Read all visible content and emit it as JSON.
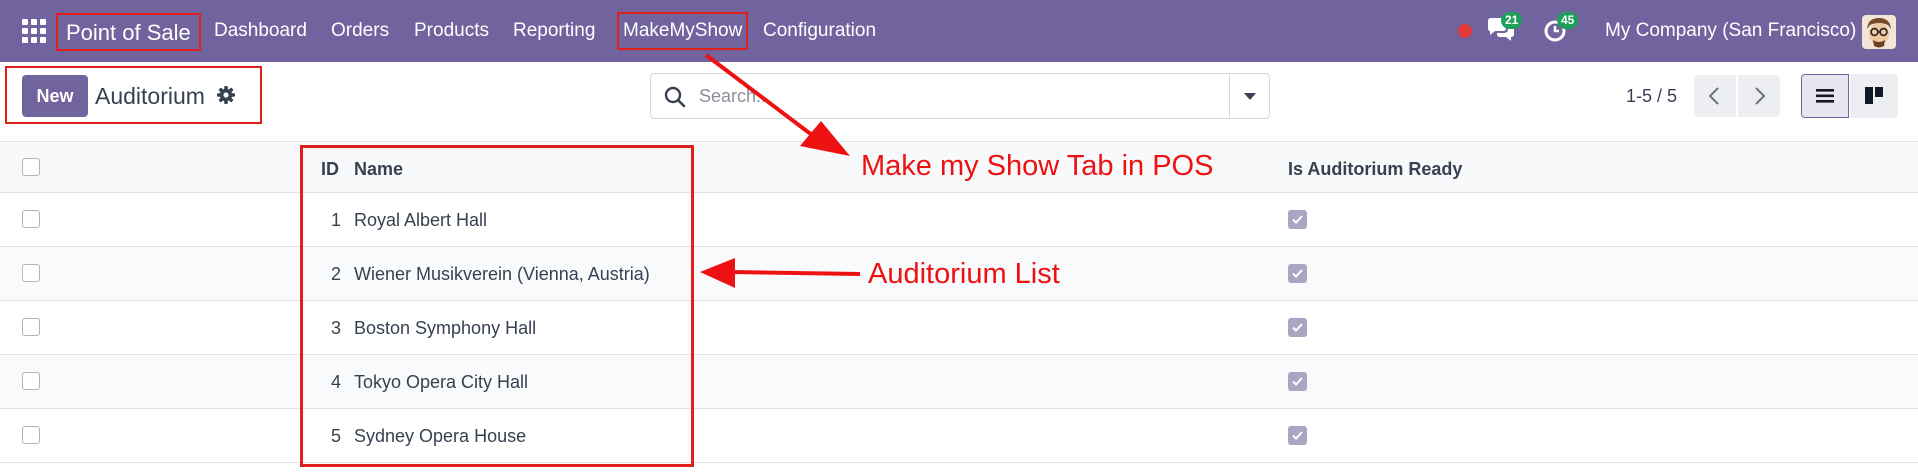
{
  "navbar": {
    "brand": "Point of Sale",
    "menu": [
      "Dashboard",
      "Orders",
      "Products",
      "Reporting",
      "MakeMyShow",
      "Configuration"
    ],
    "messages_count": "21",
    "activities_count": "45",
    "company": "My Company (San Francisco)"
  },
  "control_panel": {
    "new_label": "New",
    "breadcrumb": "Auditorium",
    "search_placeholder": "Search...",
    "pager": "1-5 / 5"
  },
  "table": {
    "columns": {
      "id": "ID",
      "name": "Name",
      "ready": "Is Auditorium Ready"
    },
    "rows": [
      {
        "id": "1",
        "name": "Royal Albert Hall",
        "ready": true
      },
      {
        "id": "2",
        "name": "Wiener Musikverein (Vienna, Austria)",
        "ready": true
      },
      {
        "id": "3",
        "name": "Boston Symphony Hall",
        "ready": true
      },
      {
        "id": "4",
        "name": "Tokyo Opera City Hall",
        "ready": true
      },
      {
        "id": "5",
        "name": "Sydney Opera House",
        "ready": true
      }
    ]
  },
  "annotations": {
    "tab_note": "Make my Show Tab in POS",
    "list_note": "Auditorium List"
  },
  "colors": {
    "brand": "#71639e",
    "annotation": "#ee1111",
    "badge": "#1fa05a",
    "checkbox_ready": "#a8a6c2"
  },
  "icons": {
    "apps": "apps-grid-icon",
    "chat": "chat-bubbles-icon",
    "activity": "clock-activity-icon",
    "settings": "gear-icon",
    "search": "search-icon",
    "list_view": "list-view-icon",
    "kanban_view": "kanban-view-icon"
  }
}
